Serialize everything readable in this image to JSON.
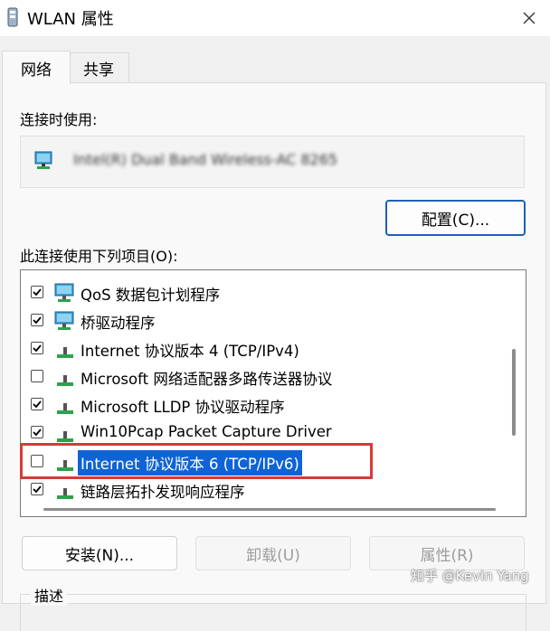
{
  "window": {
    "title": "WLAN 属性",
    "close_glyph": "✕"
  },
  "tabs": [
    {
      "label": "网络",
      "active": true
    },
    {
      "label": "共享",
      "active": false
    }
  ],
  "connect_using": {
    "label": "连接时使用:",
    "adapter_name": "Intel(R) Dual Band Wireless-AC 8265",
    "adapter_icon": "network-adapter-icon",
    "configure_label": "配置(C)..."
  },
  "items_section": {
    "label": "此连接使用下列项目(O):",
    "items": [
      {
        "label": "QoS 数据包计划程序",
        "checked": true,
        "icon": "network-service-icon",
        "selected": false
      },
      {
        "label": "桥驱动程序",
        "checked": true,
        "icon": "network-service-icon",
        "selected": false
      },
      {
        "label": "Internet 协议版本 4 (TCP/IPv4)",
        "checked": true,
        "icon": "protocol-icon",
        "selected": false
      },
      {
        "label": "Microsoft 网络适配器多路传送器协议",
        "checked": false,
        "icon": "protocol-icon",
        "selected": false
      },
      {
        "label": "Microsoft LLDP 协议驱动程序",
        "checked": true,
        "icon": "protocol-icon",
        "selected": false
      },
      {
        "label": "Win10Pcap Packet Capture Driver",
        "checked": true,
        "icon": "protocol-icon",
        "selected": false
      },
      {
        "label": "Internet 协议版本 6 (TCP/IPv6)",
        "checked": false,
        "icon": "protocol-icon",
        "selected": true
      },
      {
        "label": "链路层拓扑发现响应程序",
        "checked": true,
        "icon": "protocol-icon",
        "selected": false
      }
    ]
  },
  "buttons": {
    "install": "安装(N)...",
    "uninstall": "卸载(U)",
    "properties": "属性(R)"
  },
  "description": {
    "label": "描述"
  },
  "watermark": "知乎 @Kevin Yang",
  "colors": {
    "selection": "#0f63d6",
    "highlight_border": "#d63a3a",
    "primary_border": "#1f5fb8"
  }
}
